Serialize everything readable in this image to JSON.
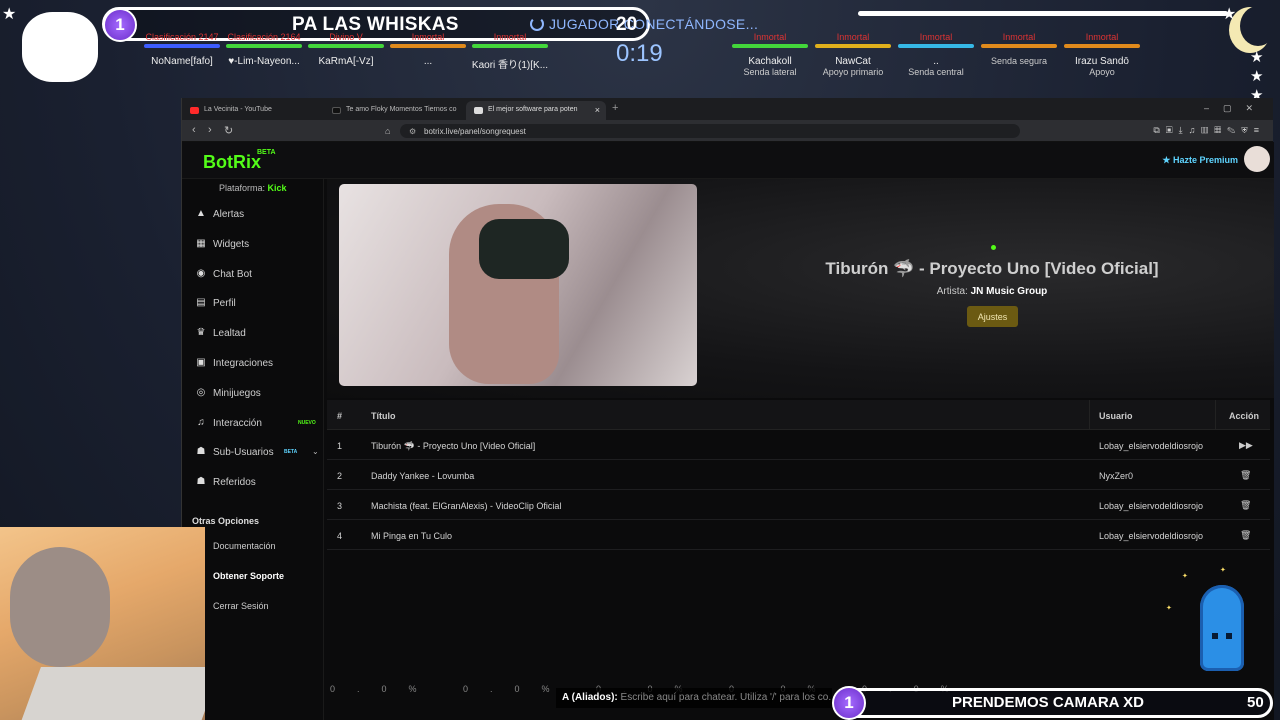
{
  "overlay": {
    "ally_rank": "1",
    "team_name": "PA LAS WHISKAS",
    "status": "JUGADOR CONECTÁNDOSE...",
    "score": "20",
    "timer": "0:19",
    "allies": [
      {
        "rank": "Clasificación 2147",
        "name": "NoName[fafo]",
        "bar": "#3d5dff"
      },
      {
        "rank": "Clasificación 2164",
        "name": "♥-Lim-Nayeon...",
        "bar": "#43d63b"
      },
      {
        "rank": "Divino V",
        "name": "KaRmA[-Vz]",
        "bar": "#43d63b"
      },
      {
        "rank": "Inmortal",
        "name": "...",
        "bar": "#e08a1c"
      },
      {
        "rank": "Inmortal",
        "name": "Kaori 香り(1)[K...",
        "bar": "#43d63b"
      }
    ],
    "enemies": [
      {
        "rank": "Inmortal",
        "name": "Kachakoll",
        "role": "Senda lateral",
        "bar": "#43d63b"
      },
      {
        "rank": "Inmortal",
        "name": "NawCat",
        "role": "Apoyo primario",
        "bar": "#e0b01c"
      },
      {
        "rank": "Inmortal",
        "name": "..",
        "role": "Senda central",
        "bar": "#36b8e6"
      },
      {
        "rank": "Inmortal",
        "name": "",
        "role": "Senda segura",
        "bar": "#e08a1c"
      },
      {
        "rank": "Inmortal",
        "name": "Irazu Sandō",
        "role": "Apoyo",
        "bar": "#e08a1c"
      }
    ],
    "bottom_rank": "1",
    "bottom_team": "PRENDEMOS CAMARA XD",
    "bottom_score": "50",
    "chat_label": "A (Aliados):",
    "chat_placeholder": "Escribe aquí para chatear. Utiliza '/' para los co...",
    "percents": "0.0% 0.0% 0.0% 0.0% 0.0%"
  },
  "browser": {
    "tabs": [
      {
        "label": "La Vecinita - YouTube",
        "color": "#ff2a2a"
      },
      {
        "label": "Te amo Floky Momentos Tiernos co",
        "color": "#111"
      },
      {
        "label": "El mejor software para poten",
        "color": "#ddd"
      }
    ],
    "url": "botrix.live/panel/songrequest"
  },
  "app": {
    "logo": "BotRix",
    "logo_badge": "BETA",
    "premium": "★ Hazte Premium",
    "platform_label": "Plataforma:",
    "platform_value": "Kick",
    "nav": [
      {
        "icon": "▲",
        "label": "Alertas"
      },
      {
        "icon": "▦",
        "label": "Widgets"
      },
      {
        "icon": "◉",
        "label": "Chat Bot"
      },
      {
        "icon": "▤",
        "label": "Perfil"
      },
      {
        "icon": "♛",
        "label": "Lealtad"
      },
      {
        "icon": "▣",
        "label": "Integraciones"
      },
      {
        "icon": "◎",
        "label": "Minijuegos"
      },
      {
        "icon": "♫",
        "label": "Interacción"
      },
      {
        "icon": "☗",
        "label": "Sub-Usuarios"
      },
      {
        "icon": "☗",
        "label": "Referidos"
      }
    ],
    "nuevo_badge": "NUEVO",
    "beta_badge": "BETA",
    "other_options": "Otras Opciones",
    "other_links": [
      "Documentación",
      "Obtener Soporte",
      "Cerrar Sesión"
    ],
    "now_playing": {
      "title": "Tiburón 🦈 - Proyecto Uno [Video Oficial]",
      "artist_label": "Artista:",
      "artist": "JN Music Group",
      "settings_button": "Ajustes"
    },
    "table": {
      "headers": {
        "num": "#",
        "title": "Título",
        "user": "Usuario",
        "action": "Acción"
      },
      "rows": [
        {
          "num": "1",
          "title": "Tiburón 🦈 - Proyecto Uno [Video Oficial]",
          "user": "Lobay_elsiervodeldiosrojo",
          "action": "▶▶"
        },
        {
          "num": "2",
          "title": "Daddy Yankee - Lovumba",
          "user": "NyxZer0",
          "action": "🗑"
        },
        {
          "num": "3",
          "title": "Machista (feat. ElGranAlexis) - VideoClip Oficial",
          "user": "Lobay_elsiervodeldiosrojo",
          "action": "🗑"
        },
        {
          "num": "4",
          "title": "Mi Pinga en Tu Culo",
          "user": "Lobay_elsiervodeldiosrojo",
          "action": "🗑"
        }
      ]
    }
  }
}
